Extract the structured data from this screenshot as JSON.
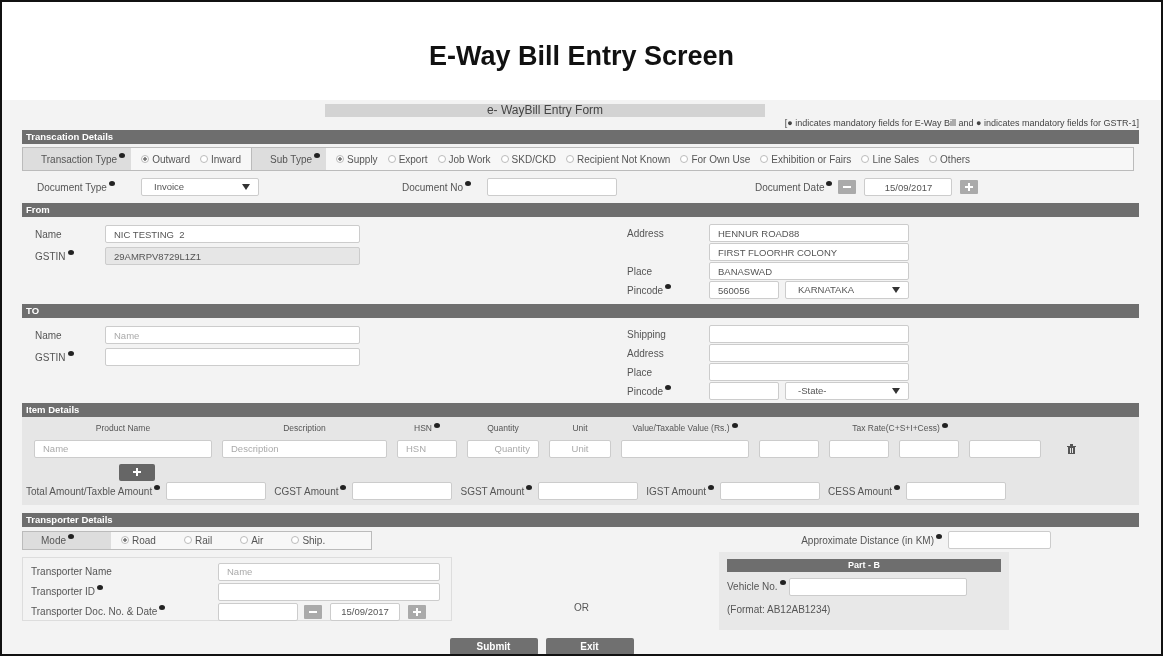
{
  "title": "E-Way Bill Entry Screen",
  "form_caption": "e- WayBill Entry Form",
  "legend_note": "[● indicates mandatory fields for E-Way Bill and ● indicates mandatory fields for GSTR-1]",
  "transaction_details": {
    "header": "Transcation Details",
    "groups": [
      {
        "label": "Transaction Type",
        "required": true,
        "options": [
          {
            "label": "Outward",
            "selected": true
          },
          {
            "label": "Inward",
            "selected": false
          }
        ]
      },
      {
        "label": "Sub Type",
        "required": true,
        "options": [
          {
            "label": "Supply",
            "selected": true
          },
          {
            "label": "Export",
            "selected": false
          },
          {
            "label": "Job Work",
            "selected": false
          },
          {
            "label": "SKD/CKD",
            "selected": false
          },
          {
            "label": "Recipient Not Known",
            "selected": false
          },
          {
            "label": "For Own Use",
            "selected": false
          },
          {
            "label": "Exhibition or Fairs",
            "selected": false
          },
          {
            "label": "Line Sales",
            "selected": false
          },
          {
            "label": "Others",
            "selected": false
          }
        ]
      }
    ]
  },
  "document": [
    {
      "kind": "select",
      "label": "Document Type",
      "required": true,
      "value": "Invoice"
    },
    {
      "kind": "text",
      "label": "Document No",
      "required": true
    },
    {
      "kind": "date",
      "label": "Document Date",
      "required": true,
      "value": "15/09/2017"
    }
  ],
  "from": {
    "header": "From",
    "left": [
      {
        "kind": "text",
        "label": "Name",
        "required": false,
        "value": "NIC TESTING  2",
        "disabled": false
      },
      {
        "kind": "text",
        "label": "GSTIN",
        "required": true,
        "value": "29AMRPV8729L1Z1",
        "disabled": true
      }
    ],
    "right": [
      {
        "kind": "text",
        "label": "Address",
        "required": false,
        "value": "HENNUR ROAD88"
      },
      {
        "kind": "text",
        "value": "FIRST FLOORHR COLONY"
      },
      {
        "kind": "text",
        "label": "Place",
        "required": false,
        "value": "BANASWAD"
      },
      {
        "kind": "pincode",
        "label": "Pincode",
        "required": true,
        "value": "560056",
        "state": "KARNATAKA"
      }
    ]
  },
  "to": {
    "header": "TO",
    "left": [
      {
        "kind": "text",
        "label": "Name",
        "required": false,
        "placeholder": "Name"
      },
      {
        "kind": "text",
        "label": "GSTIN",
        "required": true
      }
    ],
    "right": [
      {
        "kind": "text",
        "label": "Shipping",
        "required": false
      },
      {
        "kind": "text",
        "label": "Address",
        "required": false
      },
      {
        "kind": "text",
        "label": "Place",
        "required": false
      },
      {
        "kind": "pincode",
        "label": "Pincode",
        "required": true,
        "state": "-State-"
      }
    ]
  },
  "item_details": {
    "header": "Item Details",
    "columns": [
      {
        "label": "Product Name",
        "required": false
      },
      {
        "label": "Description",
        "required": false
      },
      {
        "label": "HSN",
        "required": true
      },
      {
        "label": "Quantity",
        "required": false
      },
      {
        "label": "Unit",
        "required": false
      },
      {
        "label": "Value/Taxable Value (Rs.)",
        "required": true
      },
      {
        "label": "Tax Rate(C+S+I+Cess)",
        "required": true
      }
    ],
    "inputs": [
      {
        "kind": "hint",
        "placeholder": "Name"
      },
      {
        "kind": "hint",
        "placeholder": "Description"
      },
      {
        "kind": "hint",
        "placeholder": "HSN"
      },
      {
        "kind": "hint",
        "placeholder": "Quantity"
      },
      {
        "kind": "hint",
        "placeholder": "Unit"
      },
      {
        "kind": "blank"
      },
      {
        "kind": "blank"
      },
      {
        "kind": "blank"
      },
      {
        "kind": "blank"
      },
      {
        "kind": "blank"
      }
    ],
    "totals": [
      {
        "label": "Total Amount/Taxble Amount",
        "required": true
      },
      {
        "label": "CGST Amount",
        "required": true
      },
      {
        "label": "SGST Amount",
        "required": true
      },
      {
        "label": "IGST Amount",
        "required": true
      },
      {
        "label": "CESS Amount",
        "required": true
      }
    ]
  },
  "transporter": {
    "header": "Transporter Details",
    "mode": {
      "label": "Mode",
      "required": true,
      "options": [
        {
          "label": "Road",
          "selected": true
        },
        {
          "label": "Rail",
          "selected": false
        },
        {
          "label": "Air",
          "selected": false
        },
        {
          "label": "Ship.",
          "selected": false
        }
      ]
    },
    "distance": {
      "label": "Approximate Distance (in KM)",
      "required": true
    },
    "part_a": [
      {
        "kind": "text",
        "label": "Transporter Name",
        "required": false,
        "placeholder": "Name"
      },
      {
        "kind": "text",
        "label": "Transporter ID",
        "required": true
      },
      {
        "kind": "docdate",
        "label": "Transporter Doc. No. & Date",
        "required": true,
        "value": "15/09/2017"
      }
    ],
    "separator": "OR",
    "part_b": {
      "header": "Part - B",
      "vehicle": {
        "label": "Vehicle No.",
        "required": true
      },
      "format_note": "(Format: AB12AB1234)"
    }
  },
  "buttons": [
    "Submit",
    "Exit"
  ]
}
